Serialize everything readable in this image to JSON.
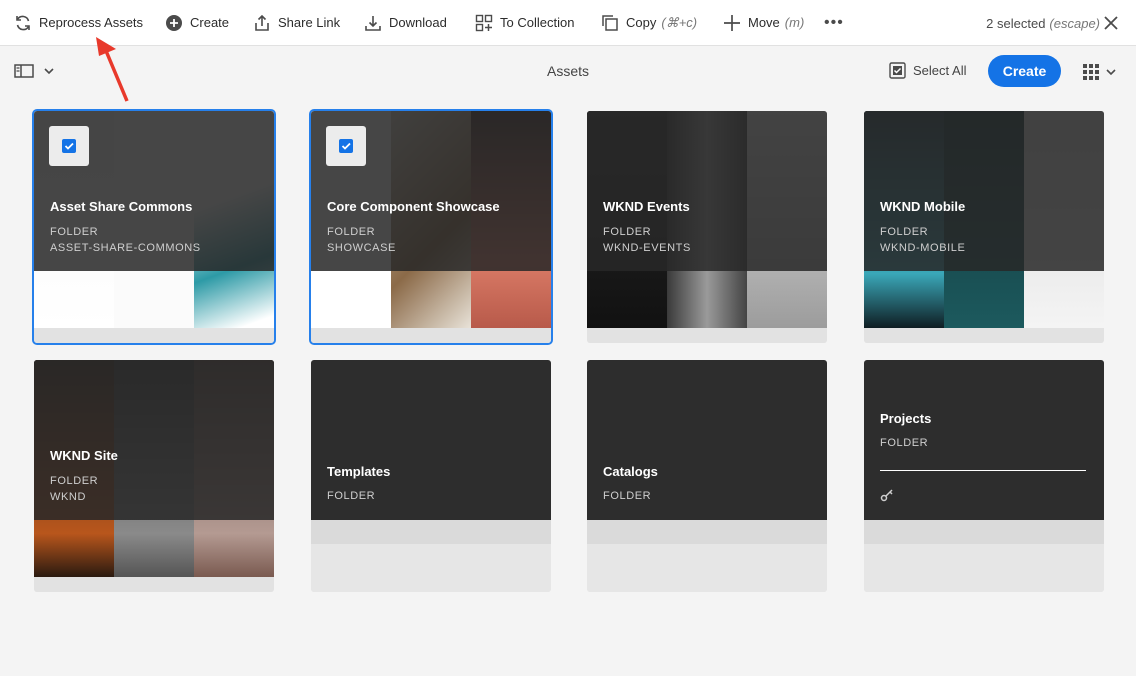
{
  "toolbar": {
    "reprocess": "Reprocess Assets",
    "create": "Create",
    "share_link": "Share Link",
    "download": "Download",
    "to_collection": "To Collection",
    "copy": "Copy",
    "copy_shortcut": "(⌘+c)",
    "move": "Move",
    "move_shortcut": "(m)",
    "more": "•••",
    "selected": "2 selected",
    "escape": "(escape)"
  },
  "header": {
    "title": "Assets",
    "select_all": "Select All",
    "create": "Create"
  },
  "cards": [
    {
      "title": "Asset Share Commons",
      "type": "FOLDER",
      "name": "ASSET-SHARE-COMMONS",
      "selected": true
    },
    {
      "title": "Core Component Showcase",
      "type": "FOLDER",
      "name": "SHOWCASE",
      "selected": true
    },
    {
      "title": "WKND Events",
      "type": "FOLDER",
      "name": "WKND-EVENTS",
      "selected": false
    },
    {
      "title": "WKND Mobile",
      "type": "FOLDER",
      "name": "WKND-MOBILE",
      "selected": false
    },
    {
      "title": "WKND Site",
      "type": "FOLDER",
      "name": "WKND",
      "selected": false
    },
    {
      "title": "Templates",
      "type": "FOLDER",
      "name": "",
      "selected": false
    },
    {
      "title": "Catalogs",
      "type": "FOLDER",
      "name": "",
      "selected": false
    },
    {
      "title": "Projects",
      "type": "FOLDER",
      "name": "",
      "selected": false
    }
  ],
  "colors": {
    "accent": "#1473e6",
    "selection_outline": "#2680eb",
    "annotation_arrow": "#e8392b"
  }
}
